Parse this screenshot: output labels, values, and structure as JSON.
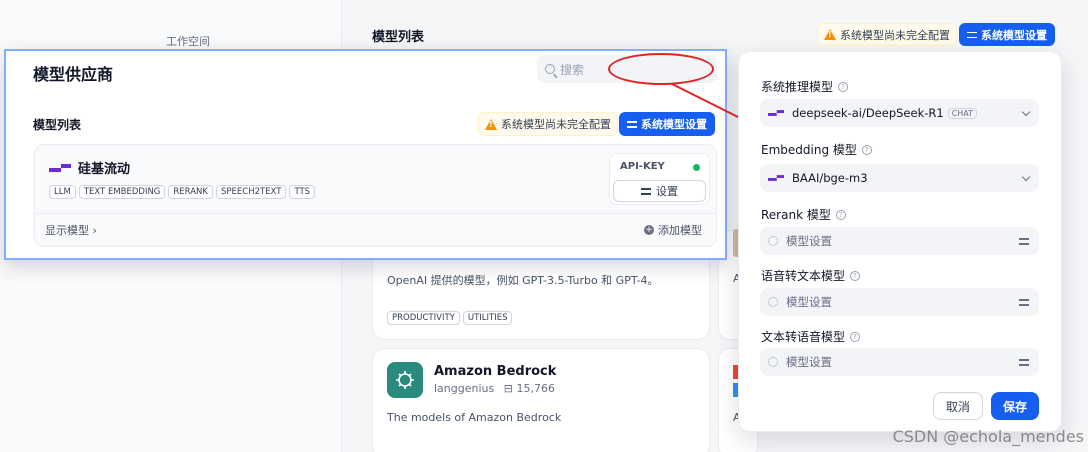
{
  "background": {
    "workspace_label": "工作空间",
    "list_title": "模型列表",
    "warning_text": "系统模型尚未完全配置",
    "system_settings_label": "系统模型设置",
    "openai_card": {
      "description": "OpenAI 提供的模型，例如 GPT-3.5-Turbo 和 GPT-4。",
      "tags": [
        "PRODUCTIVITY",
        "UTILITIES"
      ]
    },
    "bedrock_card": {
      "name": "Amazon Bedrock",
      "author": "langgenius",
      "downloads": "15,766",
      "description": "The models of Amazon Bedrock"
    },
    "right_card_letter_1": "A",
    "right_card_letter_2": "A"
  },
  "popup": {
    "title": "模型供应商",
    "search_placeholder": "搜索",
    "list_title": "模型列表",
    "warning_text": "系统模型尚未完全配置",
    "system_settings_label": "系统模型设置",
    "provider": {
      "name": "硅基流动",
      "tags": [
        "LLM",
        "TEXT EMBEDDING",
        "RERANK",
        "SPEECH2TEXT",
        "TTS"
      ],
      "api_key_label": "API-KEY",
      "settings_label": "设置",
      "show_models_label": "显示模型",
      "add_model_label": "添加模型"
    }
  },
  "panel": {
    "reasoning": {
      "label": "系统推理模型",
      "value": "deepseek-ai/DeepSeek-R1",
      "badge": "CHAT"
    },
    "embedding": {
      "label": "Embedding 模型",
      "value": "BAAI/bge-m3"
    },
    "rerank": {
      "label": "Rerank 模型",
      "placeholder": "模型设置"
    },
    "stt": {
      "label": "语音转文本模型",
      "placeholder": "模型设置"
    },
    "tts": {
      "label": "文本转语音模型",
      "placeholder": "模型设置"
    },
    "cancel_label": "取消",
    "save_label": "保存"
  },
  "watermark": "CSDN @echola_mendes",
  "colors": {
    "primary": "#155eef",
    "warning": "#f79009",
    "annotation": "#e02424",
    "provider_logo": "#6c2bd9"
  }
}
